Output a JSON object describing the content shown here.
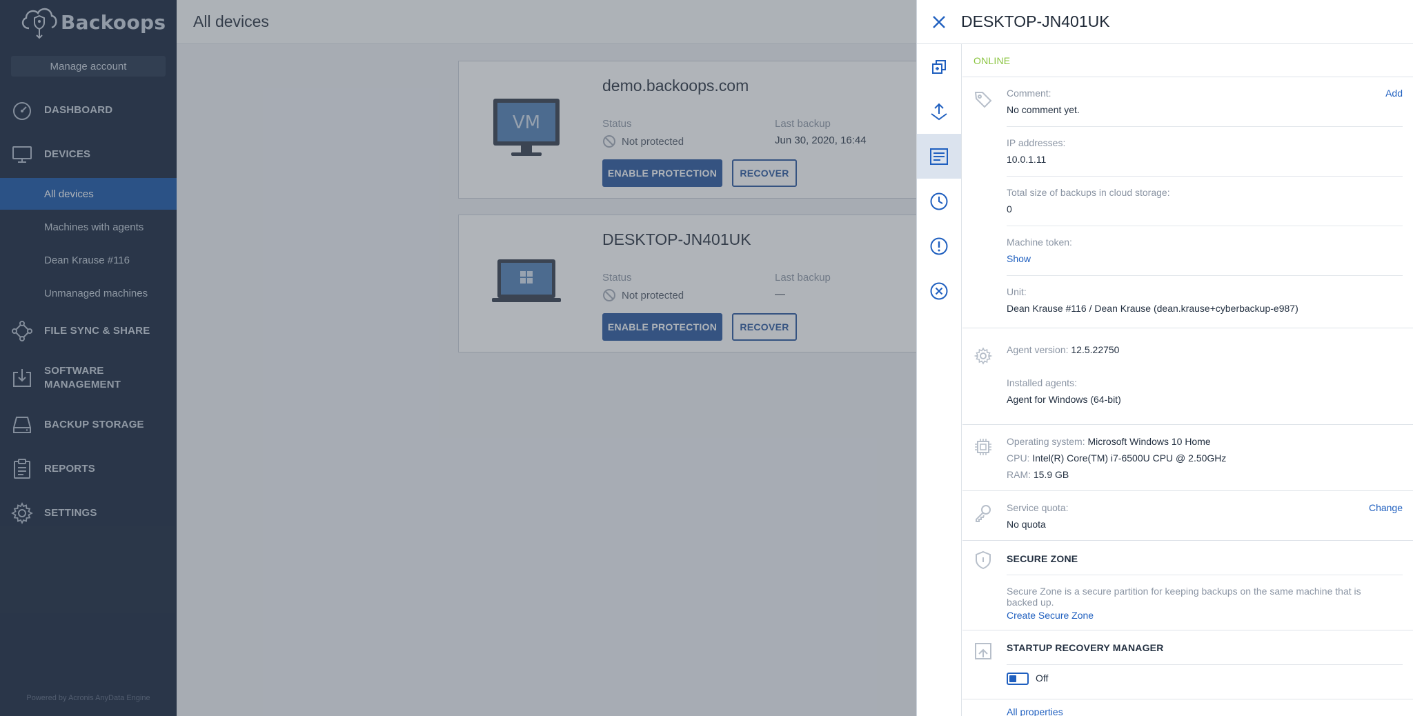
{
  "app": {
    "name": "Backoops",
    "powered_by": "Powered by Acronis AnyData Engine"
  },
  "sidebar": {
    "manage_account": "Manage account",
    "items": [
      {
        "label": "DASHBOARD",
        "icon": "speedometer-icon"
      },
      {
        "label": "DEVICES",
        "icon": "monitor-icon"
      },
      {
        "label": "FILE SYNC & SHARE",
        "icon": "network-icon"
      },
      {
        "label": "SOFTWARE MANAGEMENT",
        "label_line1": "SOFTWARE",
        "label_line2": "MANAGEMENT",
        "icon": "download-box-icon"
      },
      {
        "label": "BACKUP STORAGE",
        "icon": "storage-icon"
      },
      {
        "label": "REPORTS",
        "icon": "clipboard-icon"
      },
      {
        "label": "SETTINGS",
        "icon": "gear-icon"
      }
    ],
    "device_subitems": [
      {
        "label": "All devices",
        "active": true
      },
      {
        "label": "Machines with agents",
        "active": false
      },
      {
        "label": "Dean Krause #116",
        "active": false
      },
      {
        "label": "Unmanaged machines",
        "active": false
      }
    ]
  },
  "main": {
    "title": "All devices",
    "cards": [
      {
        "name": "demo.backoops.com",
        "image": "vm-monitor-icon",
        "image_text": "VM",
        "status_label": "Status",
        "status_value": "Not protected",
        "last_backup_label": "Last backup",
        "last_backup_value": "Jun 30, 2020, 16:44",
        "enable_label": "ENABLE PROTECTION",
        "recover_label": "RECOVER"
      },
      {
        "name": "DESKTOP-JN401UK",
        "image": "windows-laptop-icon",
        "status_label": "Status",
        "status_value": "Not protected",
        "last_backup_label": "Last backup",
        "last_backup_value": "—",
        "enable_label": "ENABLE PROTECTION",
        "recover_label": "RECOVER"
      }
    ]
  },
  "panel": {
    "title": "DESKTOP-JN401UK",
    "status": "ONLINE",
    "rail_icons": [
      "copy-icon",
      "recover-icon",
      "details-icon",
      "clock-icon",
      "alert-icon",
      "cancel-icon"
    ],
    "comment": {
      "label": "Comment:",
      "value": "No comment yet.",
      "action": "Add"
    },
    "ip": {
      "label": "IP addresses:",
      "value": "10.0.1.11"
    },
    "backup_size": {
      "label": "Total size of backups in cloud storage:",
      "value": "0"
    },
    "token": {
      "label": "Machine token:",
      "action": "Show"
    },
    "unit": {
      "label": "Unit:",
      "value": "Dean Krause #116 / Dean Krause (dean.krause+cyberbackup-e987)"
    },
    "agent_version": {
      "label": "Agent version:",
      "value": "12.5.22750"
    },
    "installed_agents": {
      "label": "Installed agents:",
      "value": "Agent for Windows (64-bit)"
    },
    "os": {
      "label": "Operating system:",
      "value": "Microsoft Windows 10 Home"
    },
    "cpu": {
      "label": "CPU:",
      "value": "Intel(R) Core(TM) i7-6500U CPU @ 2.50GHz"
    },
    "ram": {
      "label": "RAM:",
      "value": "15.9 GB"
    },
    "quota": {
      "label": "Service quota:",
      "value": "No quota",
      "action": "Change"
    },
    "secure_zone": {
      "title": "SECURE ZONE",
      "description": "Secure Zone is a secure partition for keeping backups on the same machine that is backed up.",
      "action": "Create Secure Zone"
    },
    "startup_recovery": {
      "title": "STARTUP RECOVERY MANAGER",
      "toggle_state": "Off"
    },
    "all_properties": "All properties"
  },
  "colors": {
    "sidebar_bg": "#0c1b33",
    "active_item": "#0d4da3",
    "primary": "#1f4f9a",
    "link": "#1f5fbf",
    "online": "#8ac43f"
  }
}
